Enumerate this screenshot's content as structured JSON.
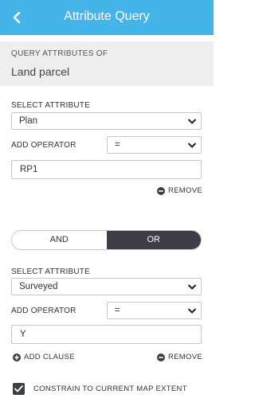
{
  "header": {
    "title": "Attribute Query",
    "back_icon": "chevron-left-icon"
  },
  "layer": {
    "caption": "QUERY ATTRIBUTES OF",
    "name": "Land parcel"
  },
  "clause1": {
    "select_attribute_label": "SELECT ATTRIBUTE",
    "attribute_value": "Plan",
    "add_operator_label": "ADD OPERATOR",
    "operator_value": "=",
    "value": "RP1",
    "remove_label": "REMOVE"
  },
  "logic_toggle": {
    "and_label": "AND",
    "or_label": "OR",
    "selected": "OR"
  },
  "clause2": {
    "select_attribute_label": "SELECT ATTRIBUTE",
    "attribute_value": "Surveyed",
    "add_operator_label": "ADD OPERATOR",
    "operator_value": "=",
    "value": "Y",
    "add_clause_label": "ADD CLAUSE",
    "remove_label": "REMOVE"
  },
  "constrain": {
    "label": "CONSTRAIN TO CURRENT MAP EXTENT",
    "checked": true
  },
  "colors": {
    "header_bg": "#45b5e9",
    "dark": "#3c3d45",
    "panel_bg": "#eeeeee"
  }
}
